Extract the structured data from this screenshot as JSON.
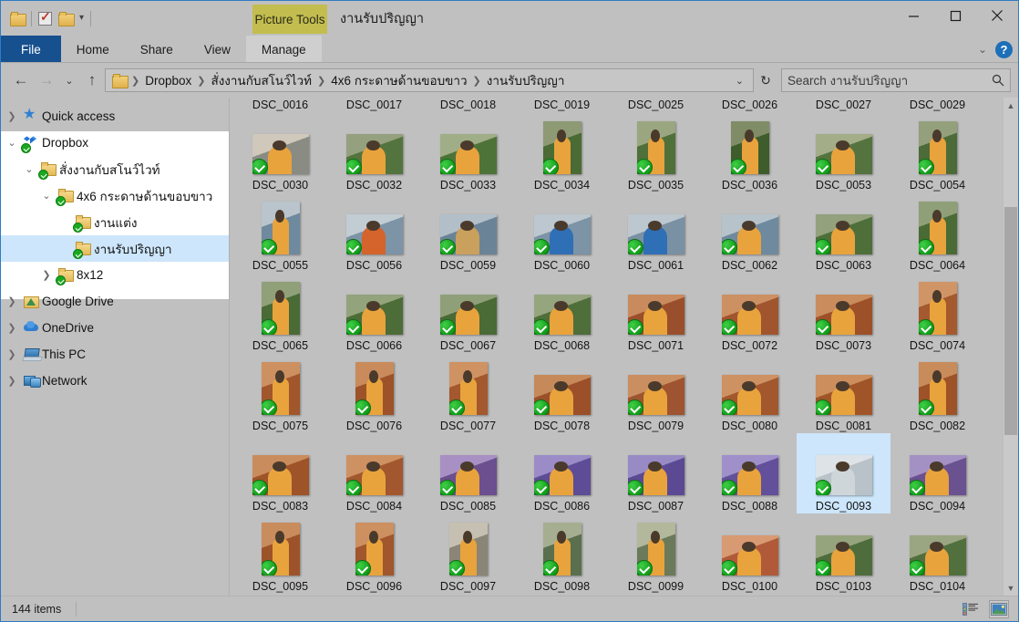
{
  "window": {
    "title": "งานรับปริญญา",
    "contextual_tab": "Picture Tools",
    "minimize_label": "Minimize",
    "maximize_label": "Maximize",
    "close_label": "Close"
  },
  "quick_access_toolbar": {
    "items": [
      {
        "name": "folder-icon",
        "label": "Properties"
      },
      {
        "name": "checkbox-icon",
        "label": "Select"
      },
      {
        "name": "folder-icon",
        "label": "New folder"
      },
      {
        "name": "chevron-down-icon",
        "label": "Customize Quick Access Toolbar"
      }
    ]
  },
  "ribbon": {
    "tabs": [
      {
        "label": "File",
        "selected": false,
        "style": "file"
      },
      {
        "label": "Home",
        "selected": false,
        "style": "normal"
      },
      {
        "label": "Share",
        "selected": false,
        "style": "normal"
      },
      {
        "label": "View",
        "selected": false,
        "style": "normal"
      },
      {
        "label": "Manage",
        "selected": true,
        "style": "manage"
      }
    ],
    "collapse_icon": "chevron-down-icon",
    "help_icon": "question-mark-icon",
    "help_label": "?"
  },
  "address_bar": {
    "back_label": "Back",
    "forward_label": "Forward",
    "recent_label": "Recent locations",
    "up_label": "Up one level",
    "refresh_label": "Refresh",
    "breadcrumb": [
      "Dropbox",
      "สั่งงานกับสโนว์ไวท์",
      "4x6 กระดาษด้านขอบขาว",
      "งานรับปริญญา"
    ],
    "dropdown_icon": "chevron-down-icon"
  },
  "search": {
    "placeholder": "Search งานรับปริญญา",
    "value": "",
    "icon": "search-icon"
  },
  "sidebar": {
    "items": [
      {
        "label": "Quick access",
        "icon": "star-icon",
        "indent": 0,
        "expander": "collapsed",
        "selected": false,
        "sync": false
      },
      {
        "label": "Dropbox",
        "icon": "dropbox-icon",
        "indent": 0,
        "expander": "expanded",
        "selected": false,
        "sync": true
      },
      {
        "label": "สั่งงานกับสโนว์ไวท์",
        "icon": "folder-icon",
        "indent": 1,
        "expander": "expanded",
        "selected": false,
        "sync": true
      },
      {
        "label": "4x6 กระดาษด้านขอบขาว",
        "icon": "folder-icon",
        "indent": 2,
        "expander": "expanded",
        "selected": false,
        "sync": true
      },
      {
        "label": "งานแต่ง",
        "icon": "folder-icon",
        "indent": 3,
        "expander": "none",
        "selected": false,
        "sync": true
      },
      {
        "label": "งานรับปริญญา",
        "icon": "folder-icon",
        "indent": 3,
        "expander": "none",
        "selected": true,
        "sync": true
      },
      {
        "label": "8x12",
        "icon": "folder-icon",
        "indent": 2,
        "expander": "collapsed",
        "selected": false,
        "sync": true
      },
      {
        "label": "Google Drive",
        "icon": "google-drive-icon",
        "indent": 0,
        "expander": "collapsed",
        "selected": false,
        "sync": false
      },
      {
        "label": "OneDrive",
        "icon": "onedrive-icon",
        "indent": 0,
        "expander": "collapsed",
        "selected": false,
        "sync": false
      },
      {
        "label": "This PC",
        "icon": "this-pc-icon",
        "indent": 0,
        "expander": "collapsed",
        "selected": false,
        "sync": false
      },
      {
        "label": "Network",
        "icon": "network-icon",
        "indent": 0,
        "expander": "collapsed",
        "selected": false,
        "sync": false
      }
    ]
  },
  "files": [
    {
      "name": "DSC_0016",
      "selected": false,
      "sync": true,
      "c1": "#6d7a55",
      "c2": "#c9c2b0",
      "c3": "#e8a33d",
      "portrait": false
    },
    {
      "name": "DSC_0017",
      "selected": false,
      "sync": true,
      "c1": "#5e7a4a",
      "c2": "#b6ae9a",
      "c3": "#e8a33d",
      "portrait": false
    },
    {
      "name": "DSC_0018",
      "selected": false,
      "sync": true,
      "c1": "#6b7f4e",
      "c2": "#bdb6a2",
      "c3": "#e8a33d",
      "portrait": false
    },
    {
      "name": "DSC_0019",
      "selected": false,
      "sync": true,
      "c1": "#4f6b3c",
      "c2": "#9aa08a",
      "c3": "#e8a33d",
      "portrait": true
    },
    {
      "name": "DSC_0025",
      "selected": false,
      "sync": true,
      "c1": "#5b7a46",
      "c2": "#b0ad97",
      "c3": "#e8a33d",
      "portrait": true
    },
    {
      "name": "DSC_0026",
      "selected": false,
      "sync": true,
      "c1": "#64794d",
      "c2": "#b8b09b",
      "c3": "#e8a33d",
      "portrait": true
    },
    {
      "name": "DSC_0027",
      "selected": false,
      "sync": true,
      "c1": "#5a7347",
      "c2": "#aeab96",
      "c3": "#e8a33d",
      "portrait": false
    },
    {
      "name": "DSC_0029",
      "selected": false,
      "sync": true,
      "c1": "#62784b",
      "c2": "#b4ac98",
      "c3": "#e8a33d",
      "portrait": false
    },
    {
      "name": "DSC_0030",
      "selected": false,
      "sync": true,
      "c1": "#8a8c84",
      "c2": "#cfc8bb",
      "c3": "#e8a33d",
      "portrait": false
    },
    {
      "name": "DSC_0032",
      "selected": false,
      "sync": true,
      "c1": "#53743e",
      "c2": "#95a07e",
      "c3": "#e8a33d",
      "portrait": false
    },
    {
      "name": "DSC_0033",
      "selected": false,
      "sync": true,
      "c1": "#4e7338",
      "c2": "#9fae86",
      "c3": "#e8a33d",
      "portrait": false
    },
    {
      "name": "DSC_0034",
      "selected": false,
      "sync": true,
      "c1": "#4a6b34",
      "c2": "#8d9a74",
      "c3": "#e8a33d",
      "portrait": true
    },
    {
      "name": "DSC_0035",
      "selected": false,
      "sync": true,
      "c1": "#50703a",
      "c2": "#9aa680",
      "c3": "#e8a33d",
      "portrait": true
    },
    {
      "name": "DSC_0036",
      "selected": false,
      "sync": true,
      "c1": "#3f5c2c",
      "c2": "#7f8c66",
      "c3": "#e8a33d",
      "portrait": true
    },
    {
      "name": "DSC_0053",
      "selected": false,
      "sync": true,
      "c1": "#55733f",
      "c2": "#a3ad88",
      "c3": "#e8a33d",
      "portrait": false
    },
    {
      "name": "DSC_0054",
      "selected": false,
      "sync": true,
      "c1": "#4d6b38",
      "c2": "#93a07b",
      "c3": "#e8a33d",
      "portrait": true
    },
    {
      "name": "DSC_0055",
      "selected": false,
      "sync": true,
      "c1": "#6f8a9e",
      "c2": "#b9c4cc",
      "c3": "#e8a33d",
      "portrait": true
    },
    {
      "name": "DSC_0056",
      "selected": false,
      "sync": true,
      "c1": "#7d93a6",
      "c2": "#c2ccd3",
      "c3": "#d4642c",
      "portrait": false
    },
    {
      "name": "DSC_0059",
      "selected": false,
      "sync": true,
      "c1": "#6b8396",
      "c2": "#b3bfc8",
      "c3": "#c9a05c",
      "portrait": false
    },
    {
      "name": "DSC_0060",
      "selected": false,
      "sync": true,
      "c1": "#7d93a6",
      "c2": "#bcc7cf",
      "c3": "#2f6fb5",
      "portrait": false
    },
    {
      "name": "DSC_0061",
      "selected": false,
      "sync": true,
      "c1": "#7a90a3",
      "c2": "#bcc7cf",
      "c3": "#2f6fb5",
      "portrait": false
    },
    {
      "name": "DSC_0062",
      "selected": false,
      "sync": true,
      "c1": "#6f8a9e",
      "c2": "#b7c3cb",
      "c3": "#e8a33d",
      "portrait": false
    },
    {
      "name": "DSC_0063",
      "selected": false,
      "sync": true,
      "c1": "#4e6f3a",
      "c2": "#93a17c",
      "c3": "#e8a33d",
      "portrait": false
    },
    {
      "name": "DSC_0064",
      "selected": false,
      "sync": true,
      "c1": "#4a6a36",
      "c2": "#8fa078",
      "c3": "#e8a33d",
      "portrait": true
    },
    {
      "name": "DSC_0065",
      "selected": false,
      "sync": true,
      "c1": "#4a6a36",
      "c2": "#90a079",
      "c3": "#e8a33d",
      "portrait": true
    },
    {
      "name": "DSC_0066",
      "selected": false,
      "sync": true,
      "c1": "#4c6c38",
      "c2": "#93a37c",
      "c3": "#e8a33d",
      "portrait": false
    },
    {
      "name": "DSC_0067",
      "selected": false,
      "sync": true,
      "c1": "#4a6a36",
      "c2": "#8fa078",
      "c3": "#e8a33d",
      "portrait": false
    },
    {
      "name": "DSC_0068",
      "selected": false,
      "sync": true,
      "c1": "#4e6e3a",
      "c2": "#95a57e",
      "c3": "#e8a33d",
      "portrait": false
    },
    {
      "name": "DSC_0071",
      "selected": false,
      "sync": true,
      "c1": "#9a4f2c",
      "c2": "#c98a5e",
      "c3": "#e8a33d",
      "portrait": false
    },
    {
      "name": "DSC_0072",
      "selected": false,
      "sync": true,
      "c1": "#a0552f",
      "c2": "#cd9063",
      "c3": "#e8a33d",
      "portrait": false
    },
    {
      "name": "DSC_0073",
      "selected": false,
      "sync": true,
      "c1": "#9c5129",
      "c2": "#c98c5c",
      "c3": "#e8a33d",
      "portrait": false
    },
    {
      "name": "DSC_0074",
      "selected": false,
      "sync": true,
      "c1": "#a4592f",
      "c2": "#d09566",
      "c3": "#e8a33d",
      "portrait": true
    },
    {
      "name": "DSC_0075",
      "selected": false,
      "sync": true,
      "c1": "#a1562c",
      "c2": "#cd9060",
      "c3": "#e8a33d",
      "portrait": true
    },
    {
      "name": "DSC_0076",
      "selected": false,
      "sync": true,
      "c1": "#9d5229",
      "c2": "#c98b5b",
      "c3": "#e8a33d",
      "portrait": true
    },
    {
      "name": "DSC_0077",
      "selected": false,
      "sync": true,
      "c1": "#a3582e",
      "c2": "#cf9263",
      "c3": "#e8a33d",
      "portrait": true
    },
    {
      "name": "DSC_0078",
      "selected": false,
      "sync": true,
      "c1": "#9b5029",
      "c2": "#c68a5a",
      "c3": "#e8a33d",
      "portrait": false
    },
    {
      "name": "DSC_0079",
      "selected": false,
      "sync": true,
      "c1": "#9e5430",
      "c2": "#ca8e61",
      "c3": "#e8a33d",
      "portrait": false
    },
    {
      "name": "DSC_0080",
      "selected": false,
      "sync": true,
      "c1": "#a2572d",
      "c2": "#ce9162",
      "c3": "#e8a33d",
      "portrait": false
    },
    {
      "name": "DSC_0081",
      "selected": false,
      "sync": true,
      "c1": "#a05529",
      "c2": "#cb8e5c",
      "c3": "#e8a33d",
      "portrait": false
    },
    {
      "name": "DSC_0082",
      "selected": false,
      "sync": true,
      "c1": "#9d5227",
      "c2": "#c88b5a",
      "c3": "#e8a33d",
      "portrait": true
    },
    {
      "name": "DSC_0083",
      "selected": false,
      "sync": true,
      "c1": "#9e5329",
      "c2": "#c98c5c",
      "c3": "#e8a33d",
      "portrait": false
    },
    {
      "name": "DSC_0084",
      "selected": false,
      "sync": true,
      "c1": "#a2572e",
      "c2": "#ce9162",
      "c3": "#e8a33d",
      "portrait": false
    },
    {
      "name": "DSC_0085",
      "selected": false,
      "sync": true,
      "c1": "#6b4f8e",
      "c2": "#a890c4",
      "c3": "#e8a33d",
      "portrait": false
    },
    {
      "name": "DSC_0086",
      "selected": false,
      "sync": true,
      "c1": "#5e4d96",
      "c2": "#9b8cc7",
      "c3": "#e8a33d",
      "portrait": false
    },
    {
      "name": "DSC_0087",
      "selected": false,
      "sync": true,
      "c1": "#5b4a93",
      "c2": "#988ac5",
      "c3": "#e8a33d",
      "portrait": false
    },
    {
      "name": "DSC_0088",
      "selected": false,
      "sync": true,
      "c1": "#63509a",
      "c2": "#9f90ca",
      "c3": "#e8a33d",
      "portrait": false
    },
    {
      "name": "DSC_0093",
      "selected": true,
      "sync": true,
      "c1": "#b9c2c9",
      "c2": "#dde3e7",
      "c3": "#cfd6da",
      "portrait": false
    },
    {
      "name": "DSC_0094",
      "selected": false,
      "sync": true,
      "c1": "#6a5190",
      "c2": "#a491c4",
      "c3": "#e8a33d",
      "portrait": false
    },
    {
      "name": "DSC_0095",
      "selected": false,
      "sync": true,
      "c1": "#9d5329",
      "c2": "#c98c5c",
      "c3": "#e8a33d",
      "portrait": true
    },
    {
      "name": "DSC_0096",
      "selected": false,
      "sync": true,
      "c1": "#a1562d",
      "c2": "#cd9060",
      "c3": "#e8a33d",
      "portrait": true
    },
    {
      "name": "DSC_0097",
      "selected": false,
      "sync": true,
      "c1": "#8a8577",
      "c2": "#c6c0b2",
      "c3": "#e8a33d",
      "portrait": true
    },
    {
      "name": "DSC_0098",
      "selected": false,
      "sync": true,
      "c1": "#5a6f4e",
      "c2": "#a6ae92",
      "c3": "#e8a33d",
      "portrait": true
    },
    {
      "name": "DSC_0099",
      "selected": false,
      "sync": true,
      "c1": "#6b7a5a",
      "c2": "#b3b89d",
      "c3": "#e8a33d",
      "portrait": true
    },
    {
      "name": "DSC_0100",
      "selected": false,
      "sync": true,
      "c1": "#b05a3a",
      "c2": "#d89a72",
      "c3": "#e8a33d",
      "portrait": false
    },
    {
      "name": "DSC_0103",
      "selected": false,
      "sync": true,
      "c1": "#4f6d3c",
      "c2": "#96a47e",
      "c3": "#e8a33d",
      "portrait": false
    },
    {
      "name": "DSC_0104",
      "selected": false,
      "sync": true,
      "c1": "#526f3e",
      "c2": "#99a681",
      "c3": "#e8a33d",
      "portrait": false
    }
  ],
  "status_bar": {
    "item_count": "144 items",
    "views": [
      {
        "name": "details-view-button",
        "label": "Details",
        "active": false
      },
      {
        "name": "large-icons-view-button",
        "label": "Large icons",
        "active": true
      }
    ]
  },
  "scrollbar": {
    "up_arrow": "chevron-up-icon",
    "down_arrow": "chevron-down-icon"
  },
  "colors": {
    "accent": "#17508f",
    "contextual_tab": "#c3bd4f",
    "selection": "#cde6fb",
    "sync_green": "#0f9a18",
    "window_bg": "#c0c0c0"
  }
}
